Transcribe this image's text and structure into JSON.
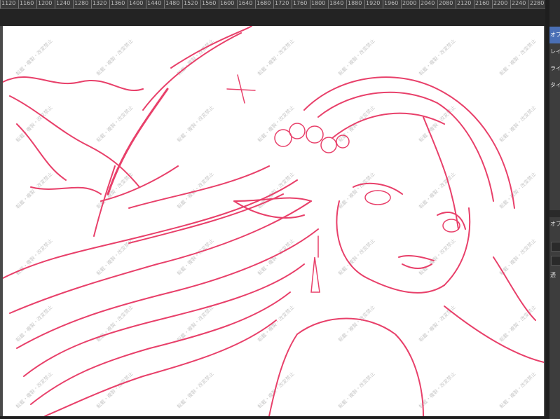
{
  "ruler": {
    "ticks": [
      "1120",
      "1160",
      "1200",
      "1240",
      "1280",
      "1320",
      "1360",
      "1400",
      "1440",
      "1480",
      "1520",
      "1560",
      "1600",
      "1640",
      "1680",
      "1720",
      "1760",
      "1800",
      "1840",
      "1880",
      "1920",
      "1960",
      "2000",
      "2040",
      "2080",
      "2120",
      "2160",
      "2200",
      "2240",
      "2280"
    ]
  },
  "panel": {
    "tabs": [
      {
        "label": "オブ",
        "active": true
      },
      {
        "label": "レイヤ",
        "active": false
      },
      {
        "label": "ライト",
        "active": false
      },
      {
        "label": "タイム",
        "active": false
      }
    ],
    "lower": {
      "label1": "オブ",
      "label2": "透"
    }
  },
  "canvas": {
    "watermark_text": "転載・複製・改変禁止",
    "sketch_color": "#e8406a"
  },
  "colors": {
    "ui_dark": "#2b2b2b",
    "accent_tab": "#4a6fb5"
  }
}
